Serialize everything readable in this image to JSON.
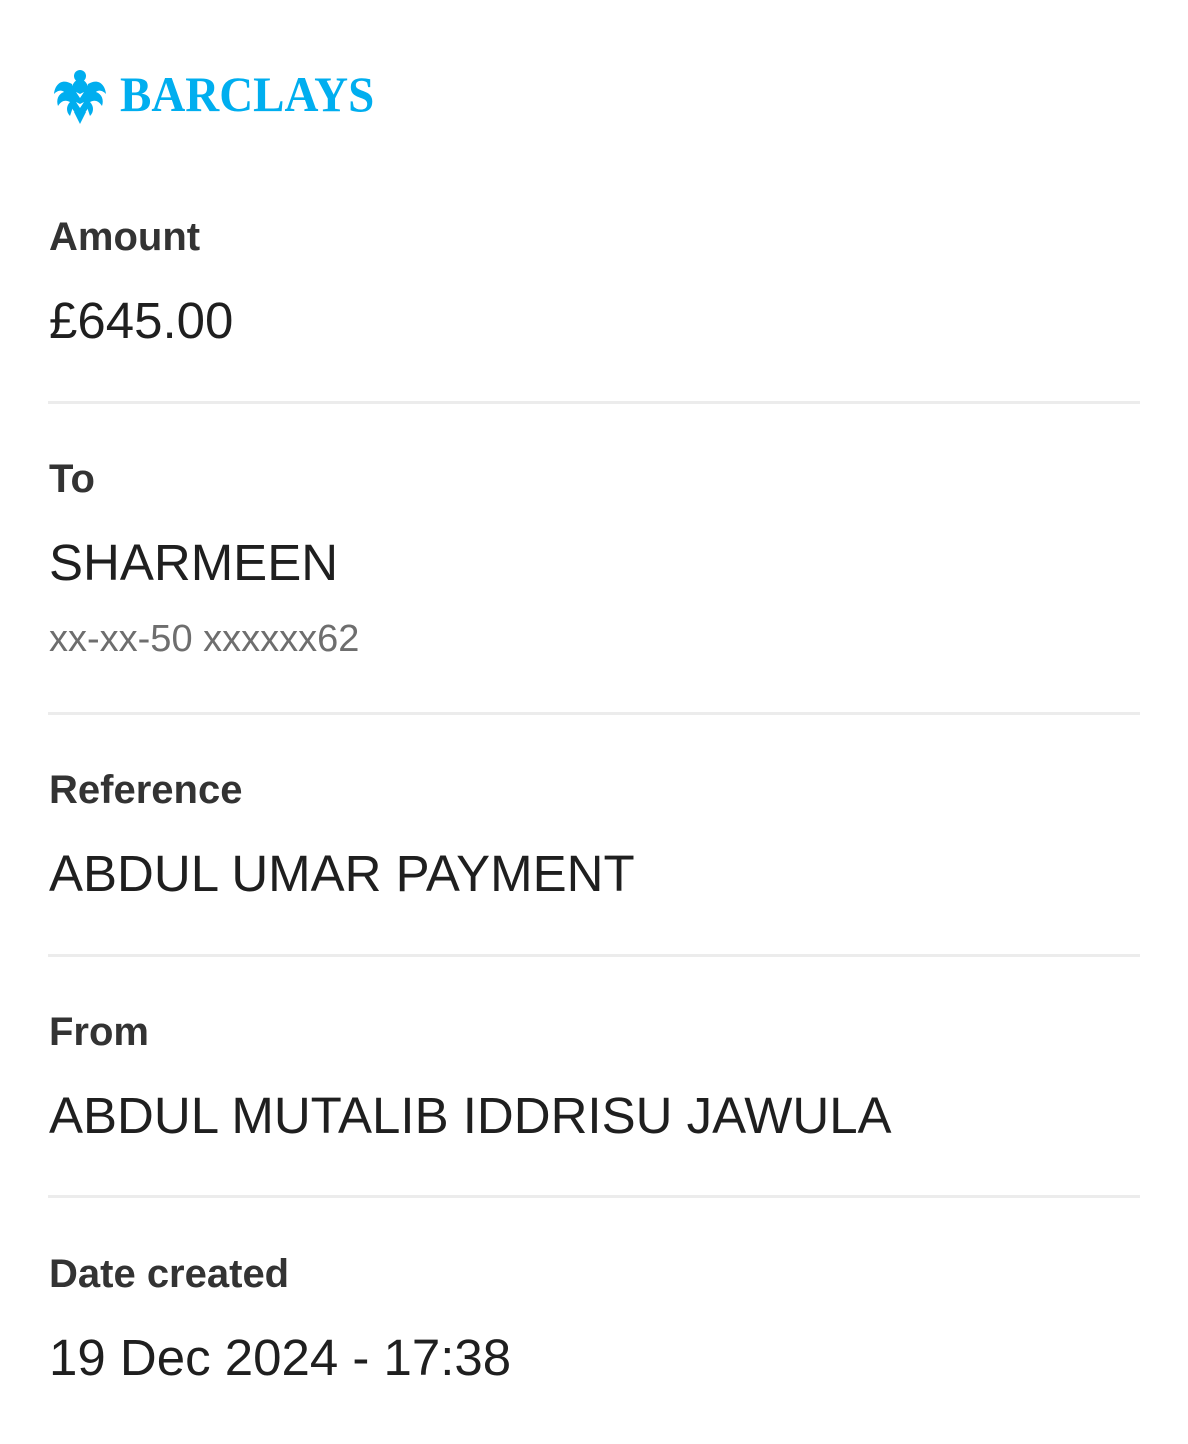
{
  "brand": {
    "name": "BARCLAYS",
    "icon": "eagle-logo-icon",
    "color": "#00aeef"
  },
  "amount": {
    "label": "Amount",
    "value": "£645.00"
  },
  "to": {
    "label": "To",
    "name": "SHARMEEN",
    "account": "xx-xx-50 xxxxxx62"
  },
  "reference": {
    "label": "Reference",
    "value": "ABDUL UMAR PAYMENT"
  },
  "from": {
    "label": "From",
    "value": "ABDUL MUTALIB IDDRISU JAWULA"
  },
  "date_created": {
    "label": "Date created",
    "value": "19 Dec 2024 - 17:38"
  }
}
